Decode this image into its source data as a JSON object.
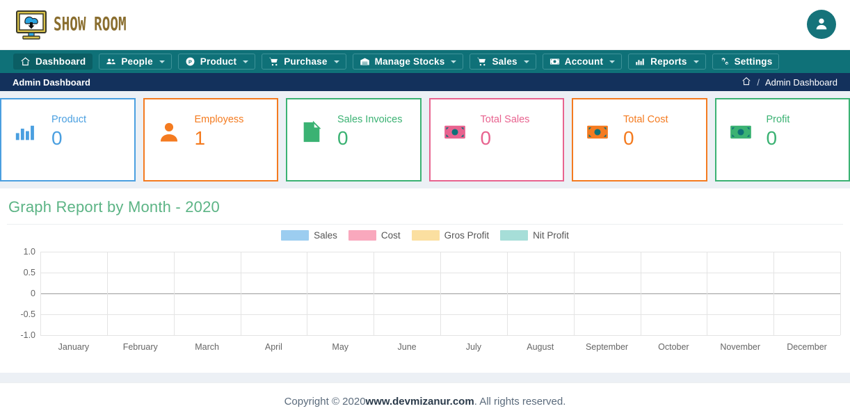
{
  "brand": {
    "name": "SHOW ROOM",
    "logo_icon": "monitor-cloud-download-icon"
  },
  "header": {
    "avatar_icon": "user-avatar-icon"
  },
  "nav": {
    "items": [
      {
        "label": "Dashboard",
        "icon": "home-icon",
        "active": true,
        "caret": false
      },
      {
        "label": "People",
        "icon": "users-icon",
        "active": false,
        "caret": true
      },
      {
        "label": "Product",
        "icon": "product-circle-icon",
        "active": false,
        "caret": true
      },
      {
        "label": "Purchase",
        "icon": "shopping-cart-icon",
        "active": false,
        "caret": true
      },
      {
        "label": "Manage Stocks",
        "icon": "warehouse-icon",
        "active": false,
        "caret": true
      },
      {
        "label": "Sales",
        "icon": "shopping-cart-icon",
        "active": false,
        "caret": true
      },
      {
        "label": "Account",
        "icon": "money-bill-icon",
        "active": false,
        "caret": true
      },
      {
        "label": "Reports",
        "icon": "bar-chart-icon",
        "active": false,
        "caret": true
      },
      {
        "label": "Settings",
        "icon": "gears-icon",
        "active": false,
        "caret": false
      }
    ]
  },
  "breadcrumb": {
    "page_title": "Admin Dashboard",
    "home_icon": "home-icon",
    "separator": "/",
    "current": "Admin Dashboard"
  },
  "cards": [
    {
      "label": "Product",
      "value": "0",
      "color": "#4a9fe0",
      "icon": "bar-chart-icon"
    },
    {
      "label": "Employess",
      "value": "1",
      "color": "#f47b20",
      "icon": "user-icon"
    },
    {
      "label": "Sales Invoices",
      "value": "0",
      "color": "#3bb273",
      "icon": "file-icon"
    },
    {
      "label": "Total Sales",
      "value": "0",
      "color": "#e8638f",
      "icon": "money-bill-icon"
    },
    {
      "label": "Total Cost",
      "value": "0",
      "color": "#f47b20",
      "icon": "money-bill-icon"
    },
    {
      "label": "Profit",
      "value": "0",
      "color": "#3bb273",
      "icon": "money-bill-icon"
    }
  ],
  "chart_panel": {
    "title": "Graph Report by Month - 2020"
  },
  "chart_data": {
    "type": "bar",
    "title": "Graph Report by Month - 2020",
    "xlabel": "",
    "ylabel": "",
    "grid": true,
    "legend_position": "top-center",
    "ylim": [
      -1.0,
      1.0
    ],
    "yticks": [
      "1.0",
      "0.5",
      "0",
      "-0.5",
      "-1.0"
    ],
    "categories": [
      "January",
      "February",
      "March",
      "April",
      "May",
      "June",
      "July",
      "August",
      "September",
      "October",
      "November",
      "December"
    ],
    "series": [
      {
        "name": "Sales",
        "color": "#9ccdf0",
        "values": [
          0,
          0,
          0,
          0,
          0,
          0,
          0,
          0,
          0,
          0,
          0,
          0
        ]
      },
      {
        "name": "Cost",
        "color": "#f9a8bd",
        "values": [
          0,
          0,
          0,
          0,
          0,
          0,
          0,
          0,
          0,
          0,
          0,
          0
        ]
      },
      {
        "name": "Gros Profit",
        "color": "#fbdfa0",
        "values": [
          0,
          0,
          0,
          0,
          0,
          0,
          0,
          0,
          0,
          0,
          0,
          0
        ]
      },
      {
        "name": "Nit Profit",
        "color": "#a6ded8",
        "values": [
          0,
          0,
          0,
          0,
          0,
          0,
          0,
          0,
          0,
          0,
          0,
          0
        ]
      }
    ]
  },
  "footer": {
    "prefix": "Copyright © 2020 ",
    "site": "www.devmizanur.com",
    "suffix": ". All rights reserved."
  }
}
